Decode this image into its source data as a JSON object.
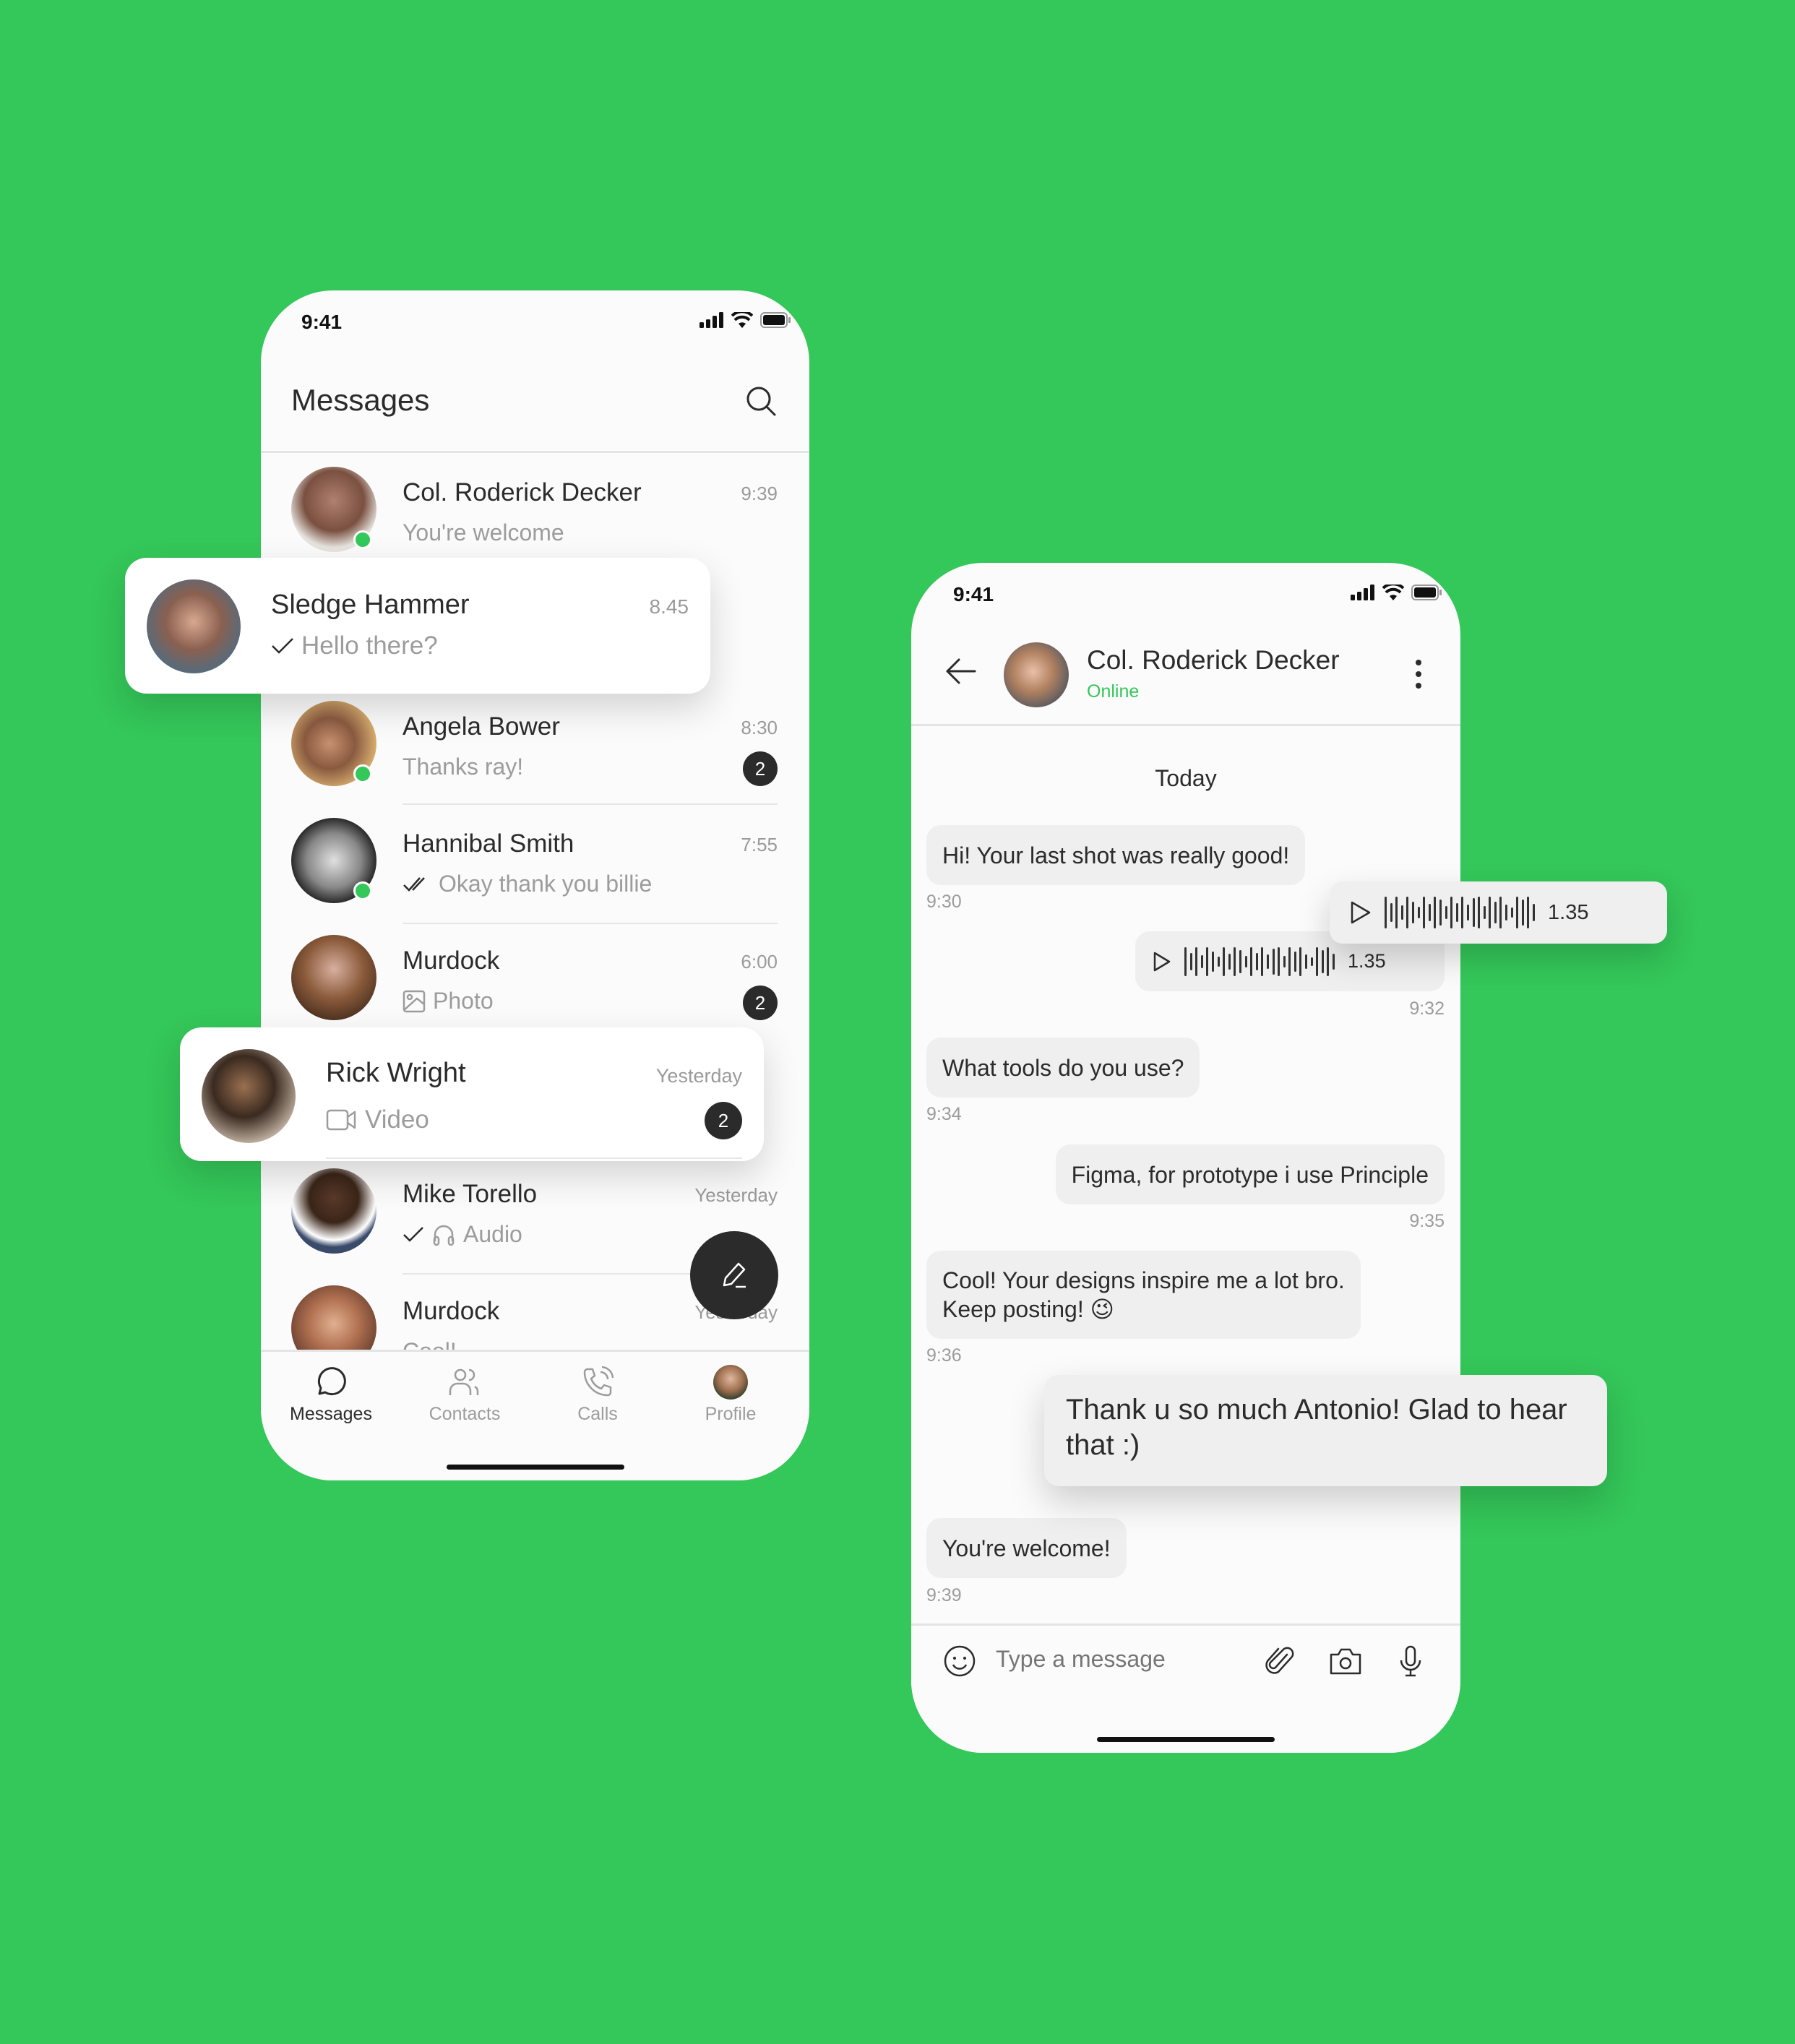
{
  "colors": {
    "background": "#34C759",
    "accent": "#34C759",
    "dark": "#2b2b2b",
    "muted": "#9c9c9c",
    "bubble": "#efefef"
  },
  "left_phone": {
    "status_time": "9:41",
    "header": {
      "title": "Messages",
      "search_icon": "search-icon"
    },
    "conversations": [
      {
        "name": "Col. Roderick Decker",
        "time": "9:39",
        "preview": "You're welcome",
        "online": true,
        "unread": null,
        "status": null
      },
      {
        "name": "Sledge Hammer",
        "time": "8.45",
        "preview": "Hello there?",
        "online": false,
        "unread": null,
        "status": "sent",
        "highlighted": true
      },
      {
        "name": "Angela Bower",
        "time": "8:30",
        "preview": "Thanks ray!",
        "online": true,
        "unread": "2",
        "status": null
      },
      {
        "name": "Hannibal Smith",
        "time": "7:55",
        "preview": "Okay thank you billie",
        "online": true,
        "unread": null,
        "status": "read"
      },
      {
        "name": "Murdock",
        "time": "6:00",
        "preview": "Photo",
        "media_icon": "image-icon",
        "online": false,
        "unread": "2",
        "status": null
      },
      {
        "name": "Rick Wright",
        "time": "Yesterday",
        "preview": "Video",
        "media_icon": "video-icon",
        "online": false,
        "unread": "2",
        "status": null,
        "highlighted": true
      },
      {
        "name": "Mike Torello",
        "time": "Yesterday",
        "preview": "Audio",
        "media_icon": "headphones-icon",
        "online": false,
        "unread": null,
        "status": "sent"
      },
      {
        "name": "Murdock",
        "time": "Yesterday",
        "preview": "Cool!",
        "online": false,
        "unread": null,
        "status": null
      }
    ],
    "fab_icon": "pencil-icon",
    "tabs": [
      {
        "label": "Messages",
        "icon": "chat-bubble-icon",
        "active": true
      },
      {
        "label": "Contacts",
        "icon": "contacts-icon",
        "active": false
      },
      {
        "label": "Calls",
        "icon": "phone-icon",
        "active": false
      },
      {
        "label": "Profile",
        "icon": "profile-avatar",
        "active": false
      }
    ]
  },
  "right_phone": {
    "status_time": "9:41",
    "header": {
      "contact_name": "Col. Roderick Decker",
      "status": "Online"
    },
    "day_label": "Today",
    "messages": [
      {
        "side": "in",
        "type": "text",
        "text": "Hi! Your last shot was really good!",
        "time": "9:30"
      },
      {
        "side": "out",
        "type": "audio",
        "duration": "1.35",
        "time": "9:32"
      },
      {
        "side": "in",
        "type": "text",
        "text": "What tools do you use?",
        "time": "9:34"
      },
      {
        "side": "out",
        "type": "text",
        "text": "Figma, for prototype i use Principle",
        "time": "9:35"
      },
      {
        "side": "in",
        "type": "text",
        "text": "Cool! Your designs inspire me a lot bro. Keep posting! 😉",
        "line1": "Cool! Your designs inspire me a lot bro.",
        "line2": "Keep posting! 😉",
        "time": "9:36"
      },
      {
        "side": "out",
        "type": "text",
        "text": "Thank u so much Antonio! Glad to hear that :)",
        "time": ""
      },
      {
        "side": "in",
        "type": "text",
        "text": "You're welcome!",
        "time": "9:39"
      }
    ],
    "floating_audio": {
      "duration": "1.35"
    },
    "composer": {
      "placeholder": "Type a message",
      "icons": [
        "emoji-icon",
        "paperclip-icon",
        "camera-icon",
        "microphone-icon"
      ]
    }
  }
}
